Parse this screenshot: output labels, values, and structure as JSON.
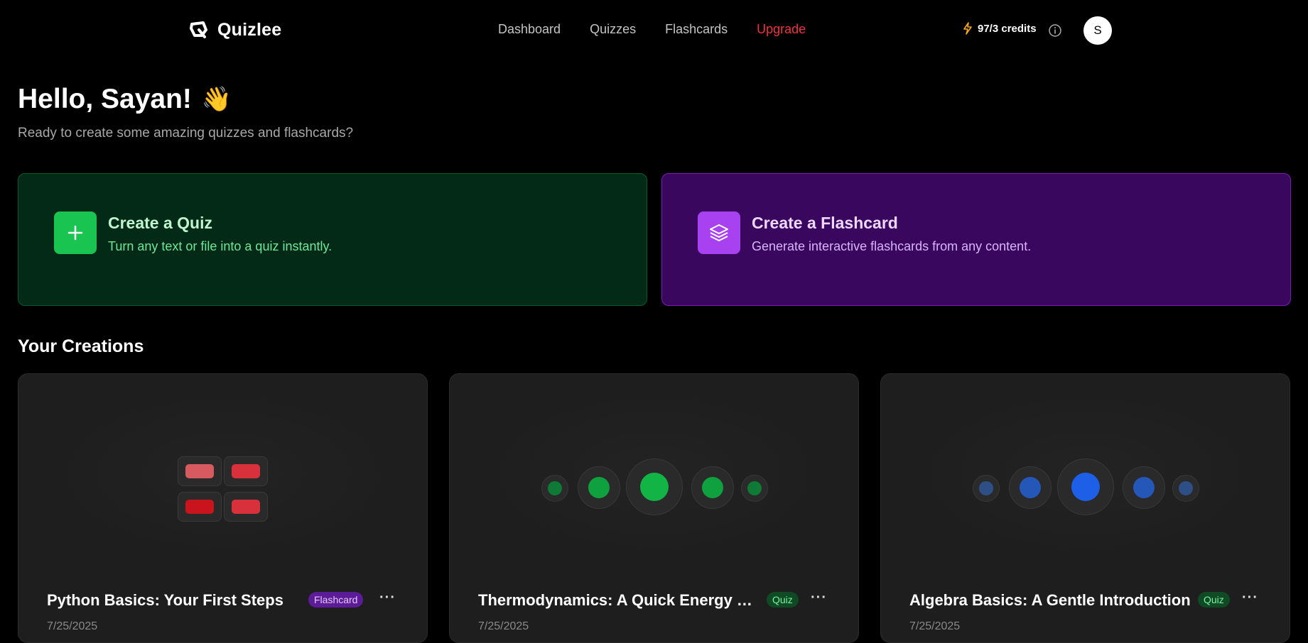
{
  "app": {
    "name": "Quizlee"
  },
  "nav": {
    "links": [
      "Dashboard",
      "Quizzes",
      "Flashcards",
      "Upgrade"
    ],
    "credits": "97/3 credits",
    "avatar_initial": "S"
  },
  "hero": {
    "greeting": "Hello, Sayan!",
    "wave": "👋",
    "subtitle": "Ready to create some amazing quizzes and flashcards?"
  },
  "actions": {
    "quiz": {
      "title": "Create a Quiz",
      "desc": "Turn any text or file into a quiz instantly."
    },
    "flashcard": {
      "title": "Create a Flashcard",
      "desc": "Generate interactive flashcards from any content."
    }
  },
  "creations": {
    "title": "Your Creations",
    "items": [
      {
        "title": "Python Basics: Your First Steps",
        "badge": "Flashcard",
        "date": "7/25/2025",
        "more": "···"
      },
      {
        "title": "Thermodynamics: A Quick Energy Guide",
        "badge": "Quiz",
        "date": "7/25/2025",
        "more": "···"
      },
      {
        "title": "Algebra Basics: A Gentle Introduction",
        "badge": "Quiz",
        "date": "7/25/2025",
        "more": "···"
      }
    ]
  },
  "icons": {
    "logo": "quizlee-logo-icon",
    "bolt": "bolt-icon",
    "info": "info-icon",
    "plus": "plus-icon",
    "layers": "layers-icon"
  },
  "colors": {
    "upgrade": "#f0313c",
    "bolt": "#f5a623",
    "quiz_accent": "#19c451",
    "flash_accent": "#a842f0",
    "blue_dot": "#1e5fe8"
  }
}
